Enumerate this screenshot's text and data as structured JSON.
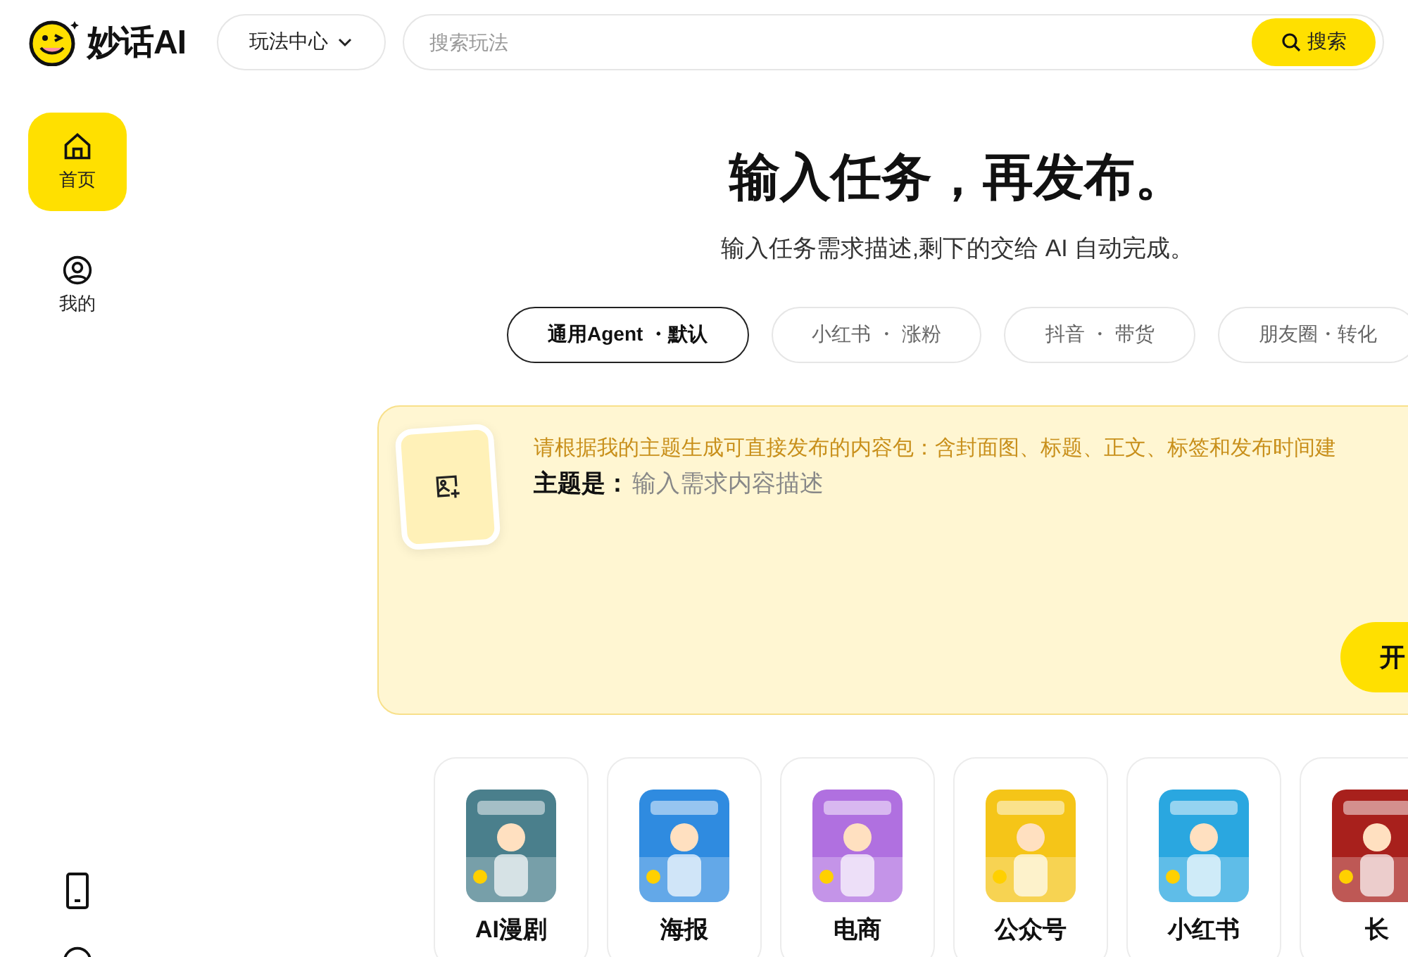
{
  "logo": {
    "text": "妙话AI"
  },
  "header": {
    "menu": "玩法中心",
    "search": {
      "placeholder": "搜索玩法",
      "button": "搜索"
    }
  },
  "sidebar": {
    "items": [
      {
        "label": "首页",
        "kind": "home",
        "selected": true
      },
      {
        "label": "我的",
        "kind": "user",
        "selected": false
      }
    ],
    "bottom_items": [
      {
        "kind": "phone"
      },
      {
        "kind": "round"
      }
    ]
  },
  "hero": {
    "title": "输入任务，再发布。",
    "subtitle": "输入任务需求描述,剩下的交给 AI 自动完成。"
  },
  "modes": [
    {
      "label": "通用Agent ・默认",
      "selected": true
    },
    {
      "label": "小红书 ・ 涨粉",
      "selected": false
    },
    {
      "label": "抖音 ・ 带货",
      "selected": false
    },
    {
      "label": "朋友圈・转化",
      "selected": false
    }
  ],
  "composer": {
    "prompt": "请根据我的主题生成可直接发布的内容包：含封面图、标题、正文、标签和发布时间建",
    "topic_label": "主题是：",
    "placeholder": "输入需求内容描述",
    "button": "开"
  },
  "categories": [
    {
      "label": "AI漫剧",
      "kind": "picture"
    },
    {
      "label": "海报",
      "kind": "picture"
    },
    {
      "label": "电商",
      "kind": "picture"
    },
    {
      "label": "公众号",
      "kind": "picture"
    },
    {
      "label": "小红书",
      "kind": "picture"
    },
    {
      "label": "长",
      "kind": "picture"
    }
  ]
}
